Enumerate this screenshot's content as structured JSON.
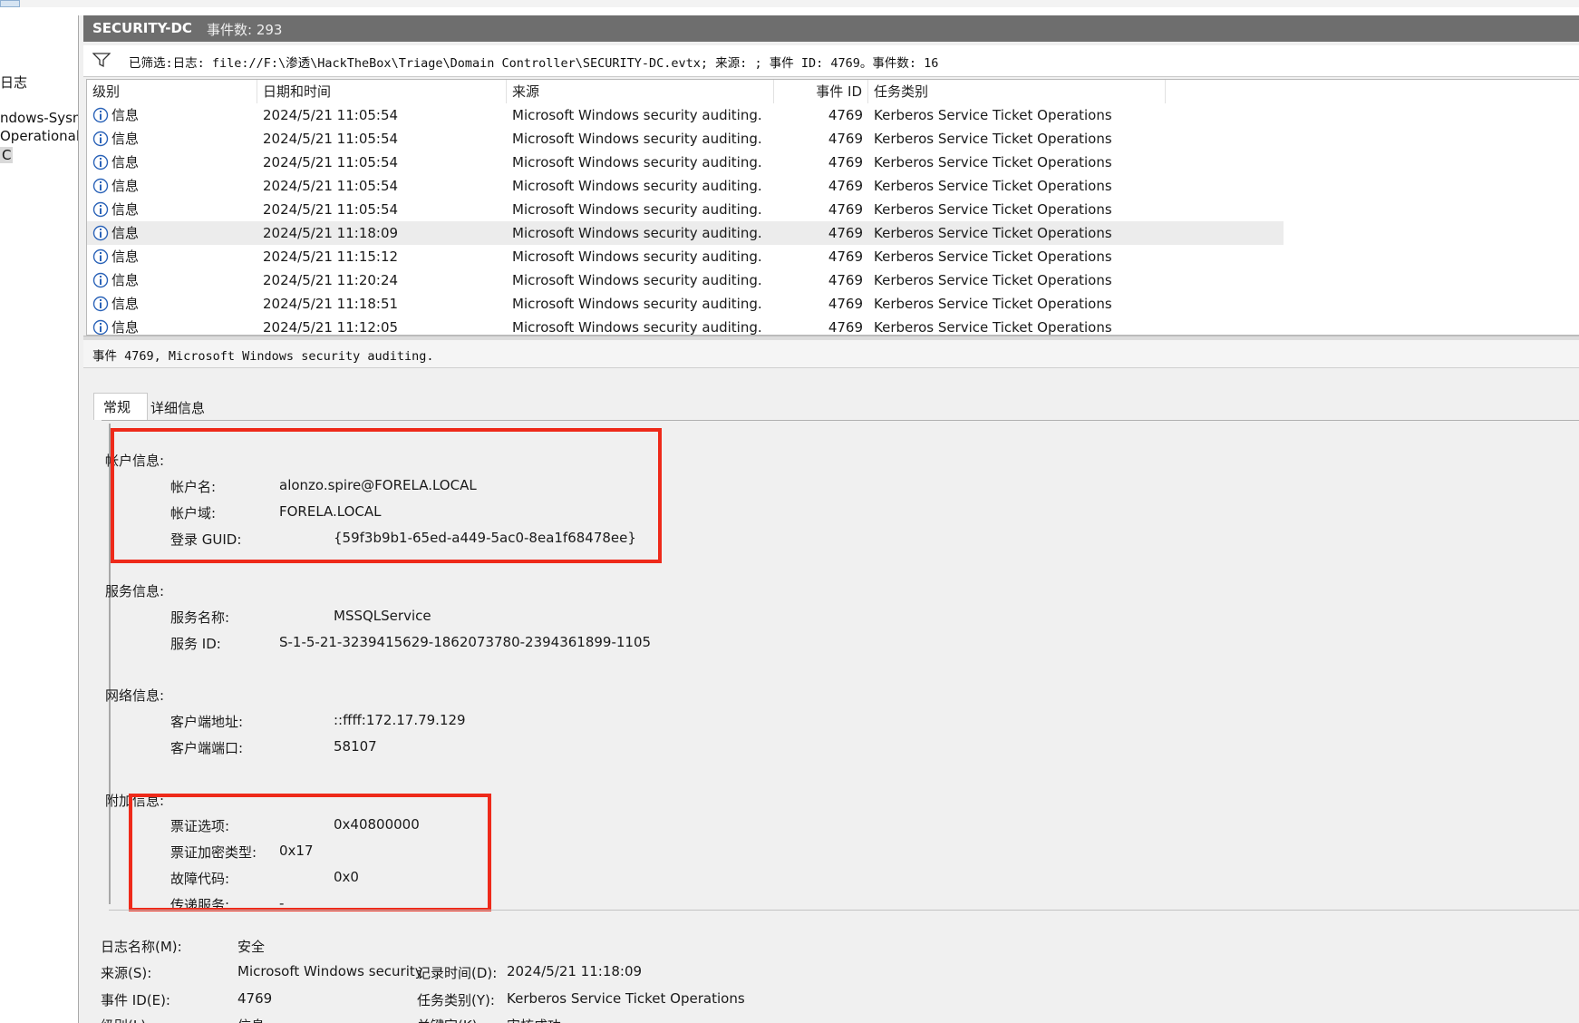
{
  "left_tree": {
    "items": [
      "日志",
      "ndows-Sysm",
      "Operational",
      "C"
    ]
  },
  "titlebar": {
    "name": "SECURITY-DC",
    "count_label": "事件数: 293"
  },
  "filter": {
    "text": "已筛选:日志: file://F:\\渗透\\HackTheBox\\Triage\\Domain Controller\\SECURITY-DC.evtx; 来源: ; 事件 ID: 4769。事件数: 16"
  },
  "list": {
    "headers": {
      "level": "级别",
      "datetime": "日期和时间",
      "source": "来源",
      "event_id": "事件 ID",
      "task": "任务类别"
    },
    "rows": [
      {
        "level": "信息",
        "datetime": "2024/5/21 11:05:54",
        "source": "Microsoft Windows security auditing.",
        "event_id": "4769",
        "task": "Kerberos Service Ticket Operations"
      },
      {
        "level": "信息",
        "datetime": "2024/5/21 11:05:54",
        "source": "Microsoft Windows security auditing.",
        "event_id": "4769",
        "task": "Kerberos Service Ticket Operations"
      },
      {
        "level": "信息",
        "datetime": "2024/5/21 11:05:54",
        "source": "Microsoft Windows security auditing.",
        "event_id": "4769",
        "task": "Kerberos Service Ticket Operations"
      },
      {
        "level": "信息",
        "datetime": "2024/5/21 11:05:54",
        "source": "Microsoft Windows security auditing.",
        "event_id": "4769",
        "task": "Kerberos Service Ticket Operations"
      },
      {
        "level": "信息",
        "datetime": "2024/5/21 11:05:54",
        "source": "Microsoft Windows security auditing.",
        "event_id": "4769",
        "task": "Kerberos Service Ticket Operations"
      },
      {
        "level": "信息",
        "datetime": "2024/5/21 11:18:09",
        "source": "Microsoft Windows security auditing.",
        "event_id": "4769",
        "task": "Kerberos Service Ticket Operations"
      },
      {
        "level": "信息",
        "datetime": "2024/5/21 11:15:12",
        "source": "Microsoft Windows security auditing.",
        "event_id": "4769",
        "task": "Kerberos Service Ticket Operations"
      },
      {
        "level": "信息",
        "datetime": "2024/5/21 11:20:24",
        "source": "Microsoft Windows security auditing.",
        "event_id": "4769",
        "task": "Kerberos Service Ticket Operations"
      },
      {
        "level": "信息",
        "datetime": "2024/5/21 11:18:51",
        "source": "Microsoft Windows security auditing.",
        "event_id": "4769",
        "task": "Kerberos Service Ticket Operations"
      },
      {
        "level": "信息",
        "datetime": "2024/5/21 11:12:05",
        "source": "Microsoft Windows security auditing.",
        "event_id": "4769",
        "task": "Kerberos Service Ticket Operations"
      }
    ]
  },
  "detail": {
    "title": "事件 4769, Microsoft Windows security auditing.",
    "tabs": [
      "常规",
      "详细信息"
    ],
    "account": {
      "heading": "帐户信息:",
      "name_label": "帐户名:",
      "name_value": "alonzo.spire@FORELA.LOCAL",
      "domain_label": "帐户域:",
      "domain_value": "FORELA.LOCAL",
      "guid_label": "登录 GUID:",
      "guid_value": "{59f3b9b1-65ed-a449-5ac0-8ea1f68478ee}"
    },
    "service": {
      "heading": "服务信息:",
      "name_label": "服务名称:",
      "name_value": "MSSQLService",
      "id_label": "服务 ID:",
      "id_value": "S-1-5-21-3239415629-1862073780-2394361899-1105"
    },
    "network": {
      "heading": "网络信息:",
      "addr_label": "客户端地址:",
      "addr_value": "::ffff:172.17.79.129",
      "port_label": "客户端端口:",
      "port_value": "58107"
    },
    "additional": {
      "heading": "附加信息:",
      "options_label": "票证选项:",
      "options_value": "0x40800000",
      "enc_label": "票证加密类型:",
      "enc_value": "0x17",
      "fail_label": "故障代码:",
      "fail_value": "0x0",
      "transit_label": "传递服务:",
      "transit_value": "-"
    },
    "footer": {
      "logname_label": "日志名称(M):",
      "logname_value": "安全",
      "source_label": "来源(S):",
      "source_value": "Microsoft Windows security",
      "logged_label": "记录时间(D):",
      "logged_value": "2024/5/21 11:18:09",
      "eventid_label": "事件 ID(E):",
      "eventid_value": "4769",
      "task_label": "任务类别(Y):",
      "task_value": "Kerberos Service Ticket Operations",
      "level_label": "级别(L):",
      "level_value": "信息",
      "keywords_label": "关键字(K):",
      "keywords_value": "审核成功"
    }
  },
  "colors": {
    "highlight_box": "#ee2a1a",
    "titlebar_bg": "#6e6e6e",
    "info_icon": "#2b63b8"
  }
}
